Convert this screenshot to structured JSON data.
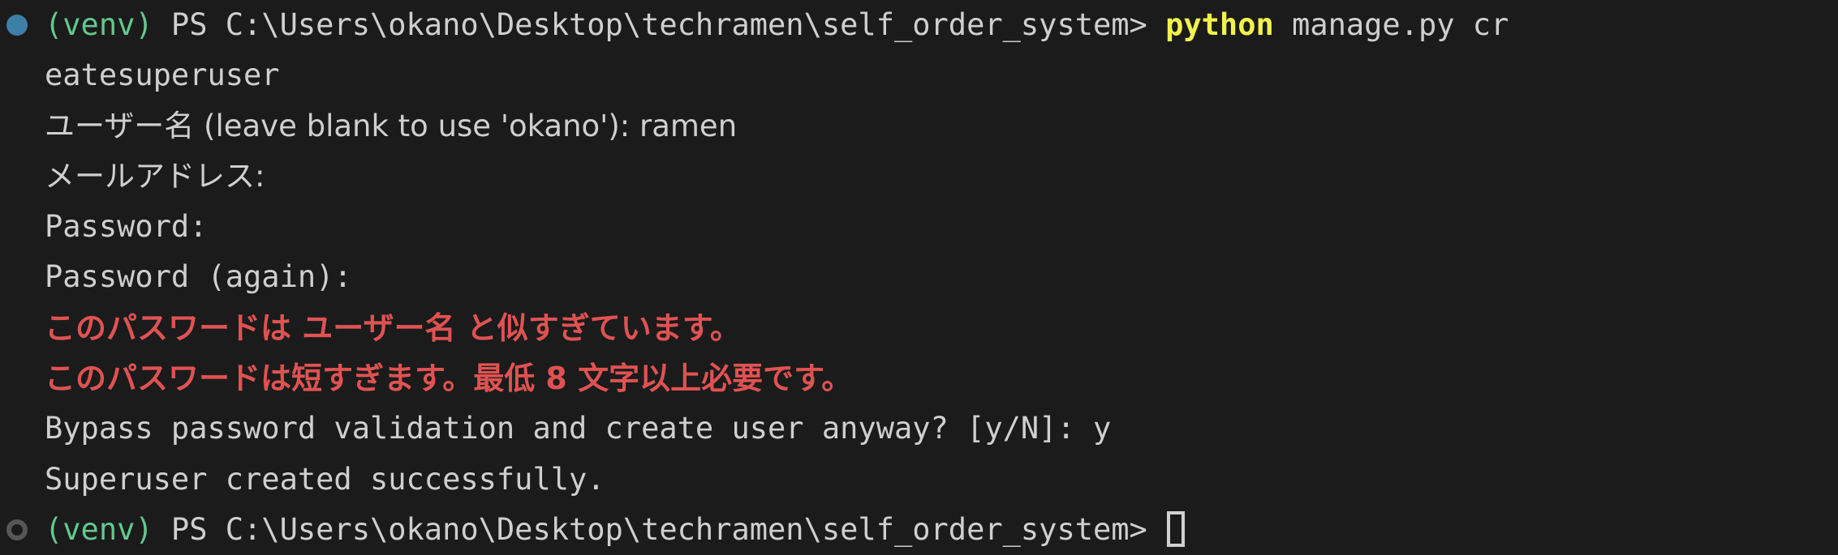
{
  "terminal": {
    "background_color": "#1b1b1b",
    "foreground_color": "#cfcfcf",
    "venv_color": "#62c98e",
    "command_color": "#f2f24e",
    "error_color": "#e05252",
    "marker_success_color": "#3e7fa8",
    "marker_idle_color": "#565656",
    "cursor_style": "block-outline"
  },
  "lines": [
    {
      "marker": "filled-circle-blue",
      "segments": [
        {
          "text": "(venv)",
          "style": "venv"
        },
        {
          "text": " PS C:\\Users\\okano\\Desktop\\techramen\\self_order_system> ",
          "style": "plain"
        },
        {
          "text": "python",
          "style": "cmd"
        },
        {
          "text": " manage.py cr",
          "style": "plain"
        }
      ]
    },
    {
      "marker": "none",
      "segments": [
        {
          "text": "eatesuperuser",
          "style": "plain"
        }
      ]
    },
    {
      "marker": "none",
      "cjk": true,
      "segments": [
        {
          "text": "ユーザー名 (leave blank to use 'okano'): ramen",
          "style": "plain"
        }
      ]
    },
    {
      "marker": "none",
      "cjk": true,
      "segments": [
        {
          "text": "メールアドレス:",
          "style": "plain"
        }
      ]
    },
    {
      "marker": "none",
      "segments": [
        {
          "text": "Password:",
          "style": "plain"
        }
      ]
    },
    {
      "marker": "none",
      "segments": [
        {
          "text": "Password (again):",
          "style": "plain"
        }
      ]
    },
    {
      "marker": "none",
      "error": true,
      "segments": [
        {
          "text": "このパスワードは ユーザー名 と似すぎています。",
          "style": "err"
        }
      ]
    },
    {
      "marker": "none",
      "error": true,
      "segments": [
        {
          "text": "このパスワードは短すぎます。最低 8 文字以上必要です。",
          "style": "err"
        }
      ]
    },
    {
      "marker": "none",
      "segments": [
        {
          "text": "Bypass password validation and create user anyway? [y/N]: y",
          "style": "plain"
        }
      ]
    },
    {
      "marker": "none",
      "segments": [
        {
          "text": "Superuser created successfully.",
          "style": "plain"
        }
      ]
    },
    {
      "marker": "hollow-circle-gray",
      "cursor": true,
      "segments": [
        {
          "text": "(venv)",
          "style": "venv"
        },
        {
          "text": " PS C:\\Users\\okano\\Desktop\\techramen\\self_order_system> ",
          "style": "plain"
        }
      ]
    }
  ]
}
